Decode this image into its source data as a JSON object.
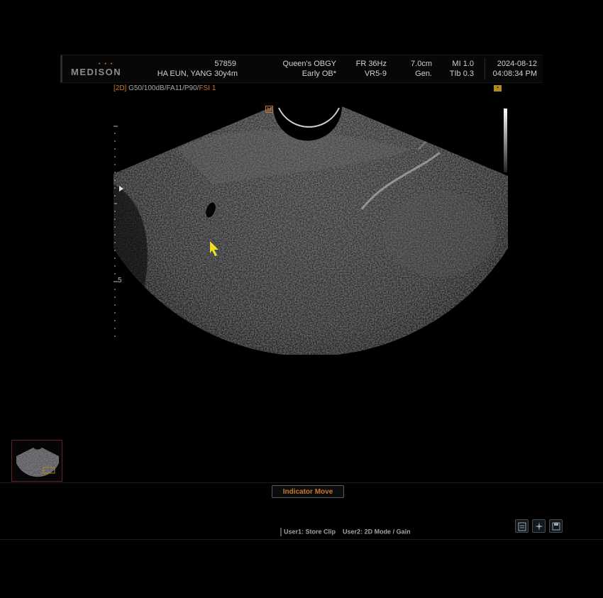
{
  "header": {
    "brand": "MEDISON",
    "patient_id": "57859",
    "patient_name": "HA EUN, YANG 30y4m",
    "institution": "Queen's OBGY",
    "application": "Early OB*",
    "frame_rate": "FR 36Hz",
    "volume_preset": "VR5-9",
    "depth": "7.0cm",
    "freq_mode": "Gen.",
    "mi": "MI 1.0",
    "tib": "TIb 0.3",
    "date": "2024-08-12",
    "time": "04:08:34 PM"
  },
  "preset_line": {
    "mode": "[2D]",
    "params": " G50/100dB/FA11/P90/",
    "fsi": "FSI 1"
  },
  "image": {
    "orientation_marker": "M",
    "depth_marker": "5"
  },
  "controls": {
    "indicator_button": "Indicator Move",
    "user1": "User1: Store Clip",
    "user2": "User2: 2D Mode / Gain"
  },
  "icons": [
    "clipboard-icon",
    "sparkle-icon",
    "save-disk-icon"
  ],
  "colors": {
    "accent_orange": "#c8782c",
    "cursor_yellow": "#f0e020"
  }
}
